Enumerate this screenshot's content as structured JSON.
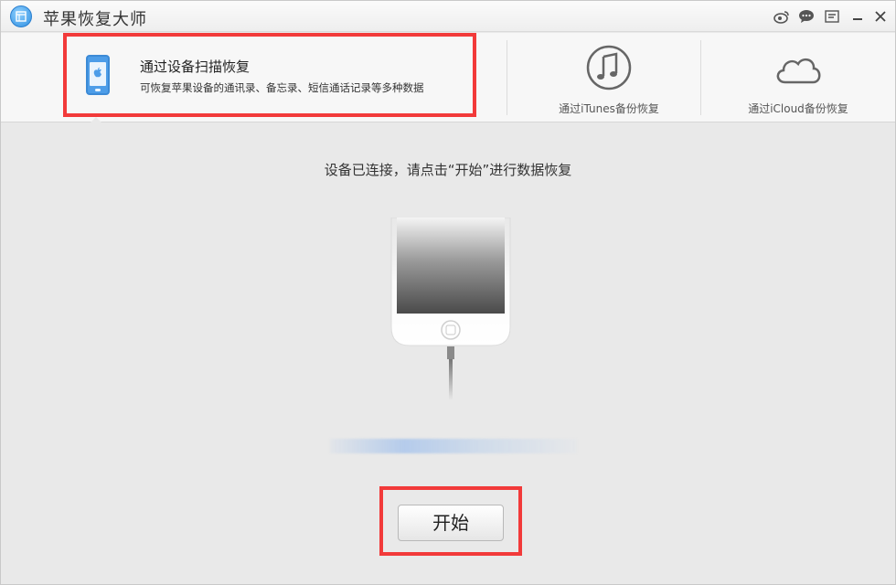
{
  "titlebar": {
    "title": "苹果恢复大师",
    "icons": [
      "weibo-icon",
      "chat-icon",
      "menu-icon",
      "minimize-icon",
      "close-icon"
    ]
  },
  "modes": {
    "device": {
      "title": "通过设备扫描恢复",
      "description": "可恢复苹果设备的通讯录、备忘录、短信通话记录等多种数据"
    },
    "itunes": {
      "label": "通过iTunes备份恢复"
    },
    "icloud": {
      "label": "通过iCloud备份恢复"
    }
  },
  "main": {
    "status": "设备已连接，请点击“开始”进行数据恢复",
    "start_label": "开始"
  },
  "colors": {
    "highlight": "#f23a3a",
    "accent": "#4d9de8"
  }
}
